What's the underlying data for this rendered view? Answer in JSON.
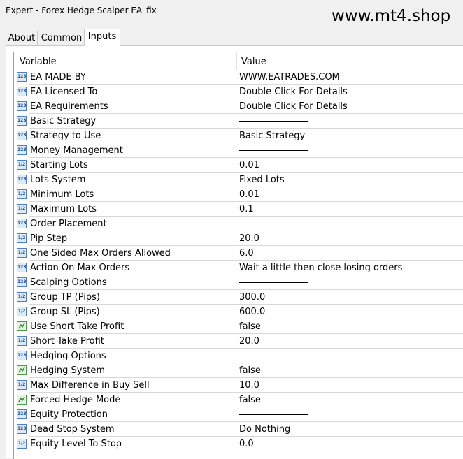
{
  "window": {
    "title": "Expert - Forex Hedge Scalper EA_fix",
    "watermark": "www.mt4.shop"
  },
  "tabs": [
    {
      "label": "About"
    },
    {
      "label": "Common"
    },
    {
      "label": "Inputs"
    }
  ],
  "active_tab": "Inputs",
  "columns": {
    "variable": "Variable",
    "value": "Value"
  },
  "rows": [
    {
      "type": "int",
      "name": "EA MADE BY",
      "value": "WWW.EATRADES.COM"
    },
    {
      "type": "int",
      "name": "EA Licensed To",
      "value": "Double Click For Details"
    },
    {
      "type": "int",
      "name": "EA Requirements",
      "value": "Double Click For Details"
    },
    {
      "type": "int",
      "name": "Basic Strategy",
      "value": "",
      "separator": true
    },
    {
      "type": "int",
      "name": "Strategy to Use",
      "value": "Basic Strategy"
    },
    {
      "type": "int",
      "name": "Money Management",
      "value": "",
      "separator": true
    },
    {
      "type": "dbl",
      "name": "Starting Lots",
      "value": "0.01"
    },
    {
      "type": "int",
      "name": "Lots System",
      "value": "Fixed Lots"
    },
    {
      "type": "dbl",
      "name": "Minimum Lots",
      "value": "0.01"
    },
    {
      "type": "dbl",
      "name": "Maximum Lots",
      "value": "0.1"
    },
    {
      "type": "int",
      "name": "Order Placement",
      "value": "",
      "separator": true
    },
    {
      "type": "dbl",
      "name": "Pip Step",
      "value": "20.0"
    },
    {
      "type": "dbl",
      "name": "One Sided Max Orders Allowed",
      "value": "6.0"
    },
    {
      "type": "int",
      "name": "Action On Max Orders",
      "value": "Wait a little then close losing orders"
    },
    {
      "type": "int",
      "name": "Scalping Options",
      "value": "",
      "separator": true
    },
    {
      "type": "dbl",
      "name": "Group TP (Pips)",
      "value": "300.0"
    },
    {
      "type": "dbl",
      "name": "Group SL (Pips)",
      "value": "600.0"
    },
    {
      "type": "bool",
      "name": "Use Short Take Profit",
      "value": "false"
    },
    {
      "type": "dbl",
      "name": "Short Take Profit",
      "value": "20.0"
    },
    {
      "type": "int",
      "name": "Hedging Options",
      "value": "",
      "separator": true
    },
    {
      "type": "bool",
      "name": "Hedging System",
      "value": "false"
    },
    {
      "type": "dbl",
      "name": "Max Difference in Buy Sell",
      "value": "10.0"
    },
    {
      "type": "bool",
      "name": "Forced Hedge Mode",
      "value": "false"
    },
    {
      "type": "int",
      "name": "Equity Protection",
      "value": "",
      "separator": true
    },
    {
      "type": "int",
      "name": "Dead Stop System",
      "value": "Do Nothing"
    },
    {
      "type": "dbl",
      "name": "Equity Level To Stop",
      "value": "0.0"
    }
  ],
  "icon_names": {
    "int": "integer-type-icon",
    "dbl": "double-type-icon",
    "bool": "boolean-type-icon"
  }
}
